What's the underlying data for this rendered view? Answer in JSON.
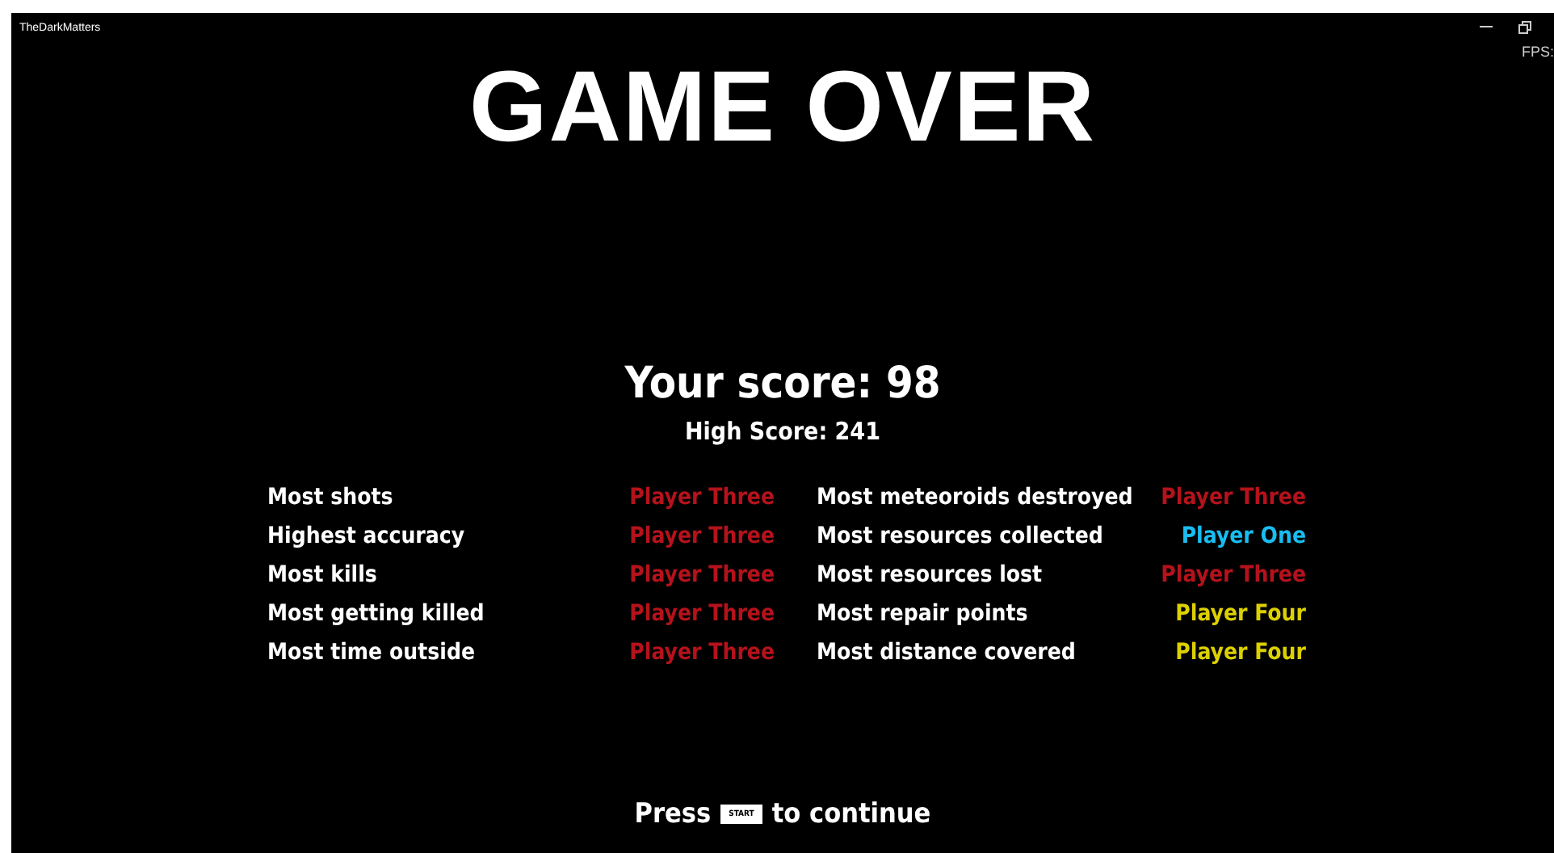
{
  "window": {
    "title": "TheDarkMatters"
  },
  "fps": "FPS:",
  "title": "GAME OVER",
  "score": "Your score: 98",
  "high_score": "High Score: 241",
  "awards_left": [
    {
      "label": "Most shots",
      "player": "Player Three",
      "color": "#b5121b"
    },
    {
      "label": "Highest accuracy",
      "player": "Player Three",
      "color": "#b5121b"
    },
    {
      "label": "Most kills",
      "player": "Player Three",
      "color": "#b5121b"
    },
    {
      "label": "Most getting killed",
      "player": "Player Three",
      "color": "#b5121b"
    },
    {
      "label": "Most time outside",
      "player": "Player Three",
      "color": "#b5121b"
    }
  ],
  "awards_right": [
    {
      "label": "Most meteoroids destroyed",
      "player": "Player Three",
      "color": "#b5121b"
    },
    {
      "label": "Most resources collected",
      "player": "Player One",
      "color": "#19bdf0"
    },
    {
      "label": "Most resources lost",
      "player": "Player Three",
      "color": "#b5121b"
    },
    {
      "label": "Most repair points",
      "player": "Player Four",
      "color": "#dcd000"
    },
    {
      "label": "Most distance covered",
      "player": "Player Four",
      "color": "#dcd000"
    }
  ],
  "prompt": {
    "before": "Press",
    "key": "START",
    "after": "to continue"
  }
}
